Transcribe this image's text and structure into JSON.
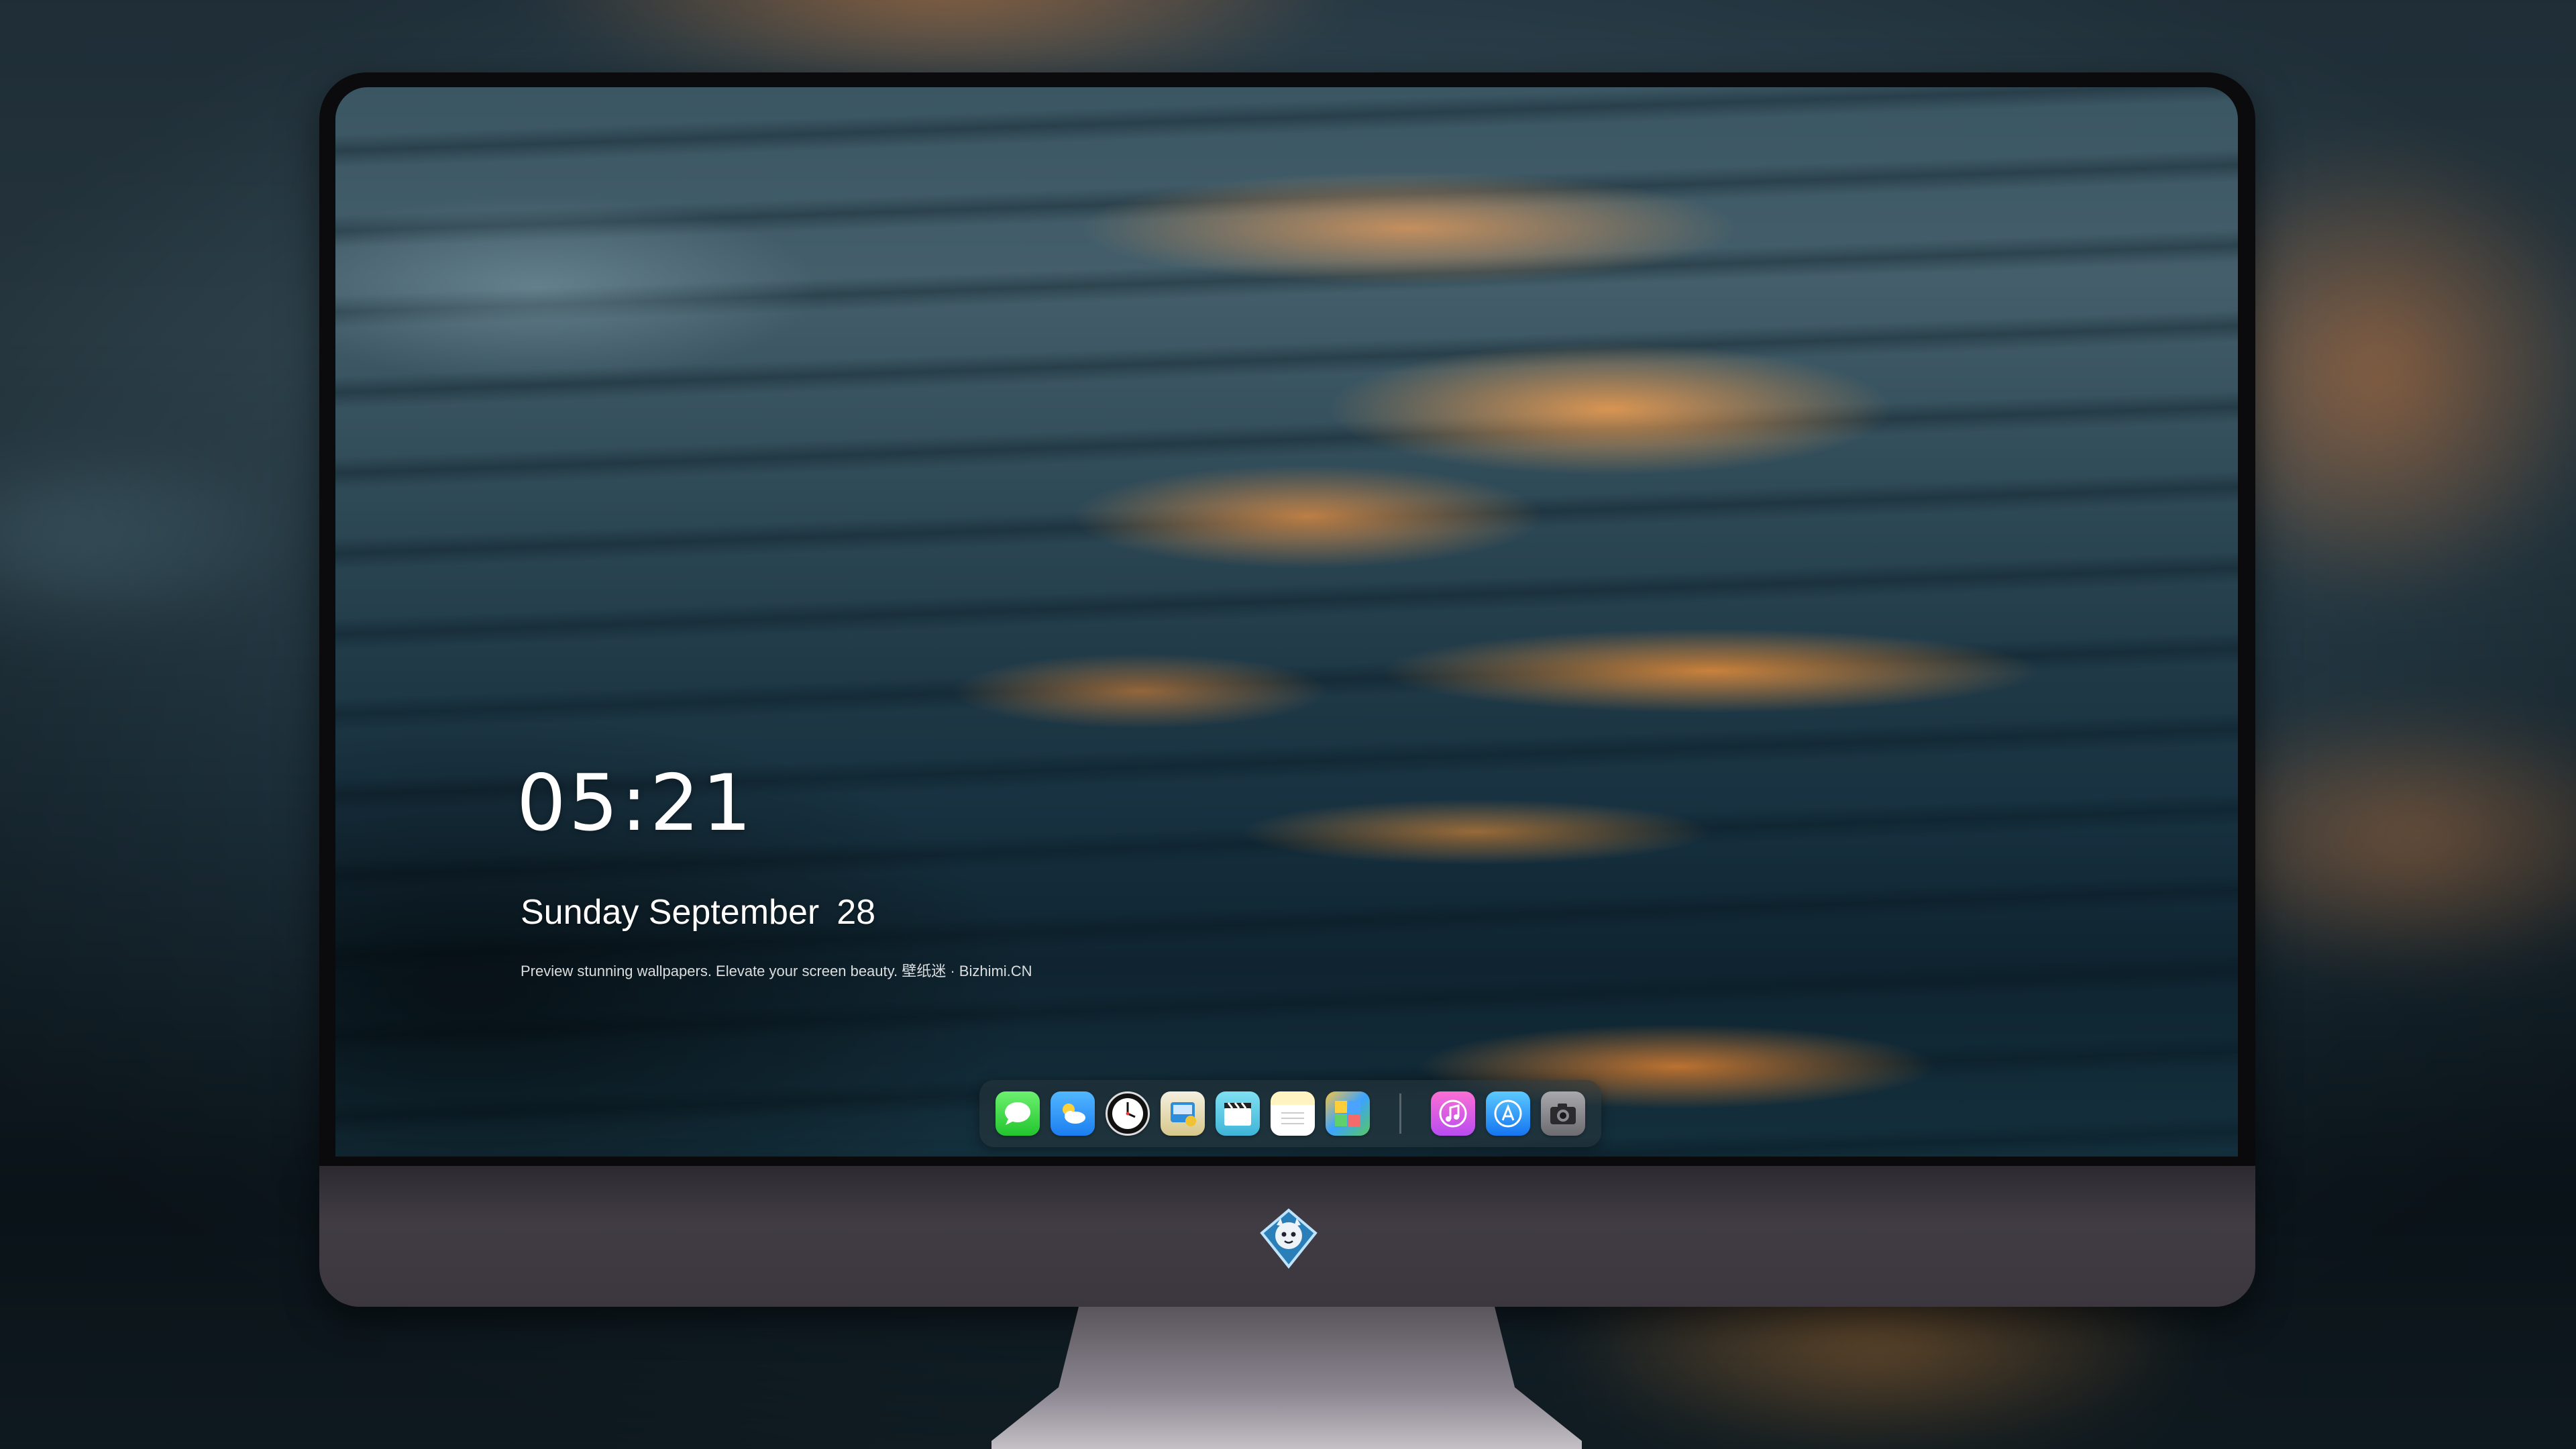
{
  "lockscreen": {
    "time": "05:21",
    "weekday_month": "Sunday September",
    "day": "28",
    "tagline": "Preview stunning wallpapers. Elevate your screen beauty. 壁纸迷 · Bizhimi.CN"
  },
  "dock": {
    "apps": [
      {
        "name": "messages-icon",
        "glyph": "💬"
      },
      {
        "name": "weather-icon",
        "glyph": "☁"
      },
      {
        "name": "clock-icon",
        "glyph": "🕐"
      },
      {
        "name": "finder-icon",
        "glyph": "☺"
      },
      {
        "name": "clips-icon",
        "glyph": "🎬"
      },
      {
        "name": "notes-icon",
        "glyph": "≡"
      },
      {
        "name": "photos-icon",
        "glyph": "▦"
      },
      {
        "name": "music-icon",
        "glyph": "♫"
      },
      {
        "name": "app-store-icon",
        "glyph": "Ⓐ"
      },
      {
        "name": "camera-icon",
        "glyph": "📷"
      }
    ]
  },
  "monitor": {
    "logo_icon": "bizhimi-mascot-logo"
  }
}
